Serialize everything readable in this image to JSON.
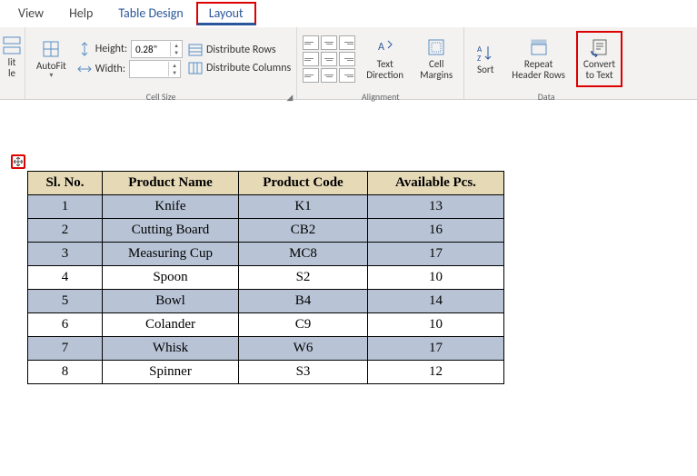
{
  "menu": {
    "view": "View",
    "help": "Help",
    "table_design": "Table Design",
    "layout": "Layout"
  },
  "ribbon": {
    "split_label": "lit",
    "split_label2": "le",
    "autofit": "AutoFit",
    "height_label": "Height:",
    "height_value": "0.28\"",
    "width_label": "Width:",
    "width_value": "",
    "dist_rows": "Distribute Rows",
    "dist_cols": "Distribute Columns",
    "cell_size": "Cell Size",
    "text_dir": "Text",
    "text_dir2": "Direction",
    "cell_margins": "Cell",
    "cell_margins2": "Margins",
    "alignment": "Alignment",
    "sort": "Sort",
    "repeat_hdr": "Repeat",
    "repeat_hdr2": "Header Rows",
    "convert": "Convert",
    "convert2": "to Text",
    "data": "Data"
  },
  "table": {
    "headers": [
      "Sl. No.",
      "Product Name",
      "Product Code",
      "Available Pcs."
    ],
    "rows": [
      {
        "sl": "1",
        "name": "Knife",
        "code": "K1",
        "pcs": "13"
      },
      {
        "sl": "2",
        "name": "Cutting Board",
        "code": "CB2",
        "pcs": "16"
      },
      {
        "sl": "3",
        "name": "Measuring Cup",
        "code": "MC8",
        "pcs": "17"
      },
      {
        "sl": "4",
        "name": "Spoon",
        "code": "S2",
        "pcs": "10"
      },
      {
        "sl": "5",
        "name": "Bowl",
        "code": "B4",
        "pcs": "14"
      },
      {
        "sl": "6",
        "name": "Colander",
        "code": "C9",
        "pcs": "10"
      },
      {
        "sl": "7",
        "name": "Whisk",
        "code": "W6",
        "pcs": "17"
      },
      {
        "sl": "8",
        "name": "Spinner",
        "code": "S3",
        "pcs": "12"
      }
    ]
  }
}
